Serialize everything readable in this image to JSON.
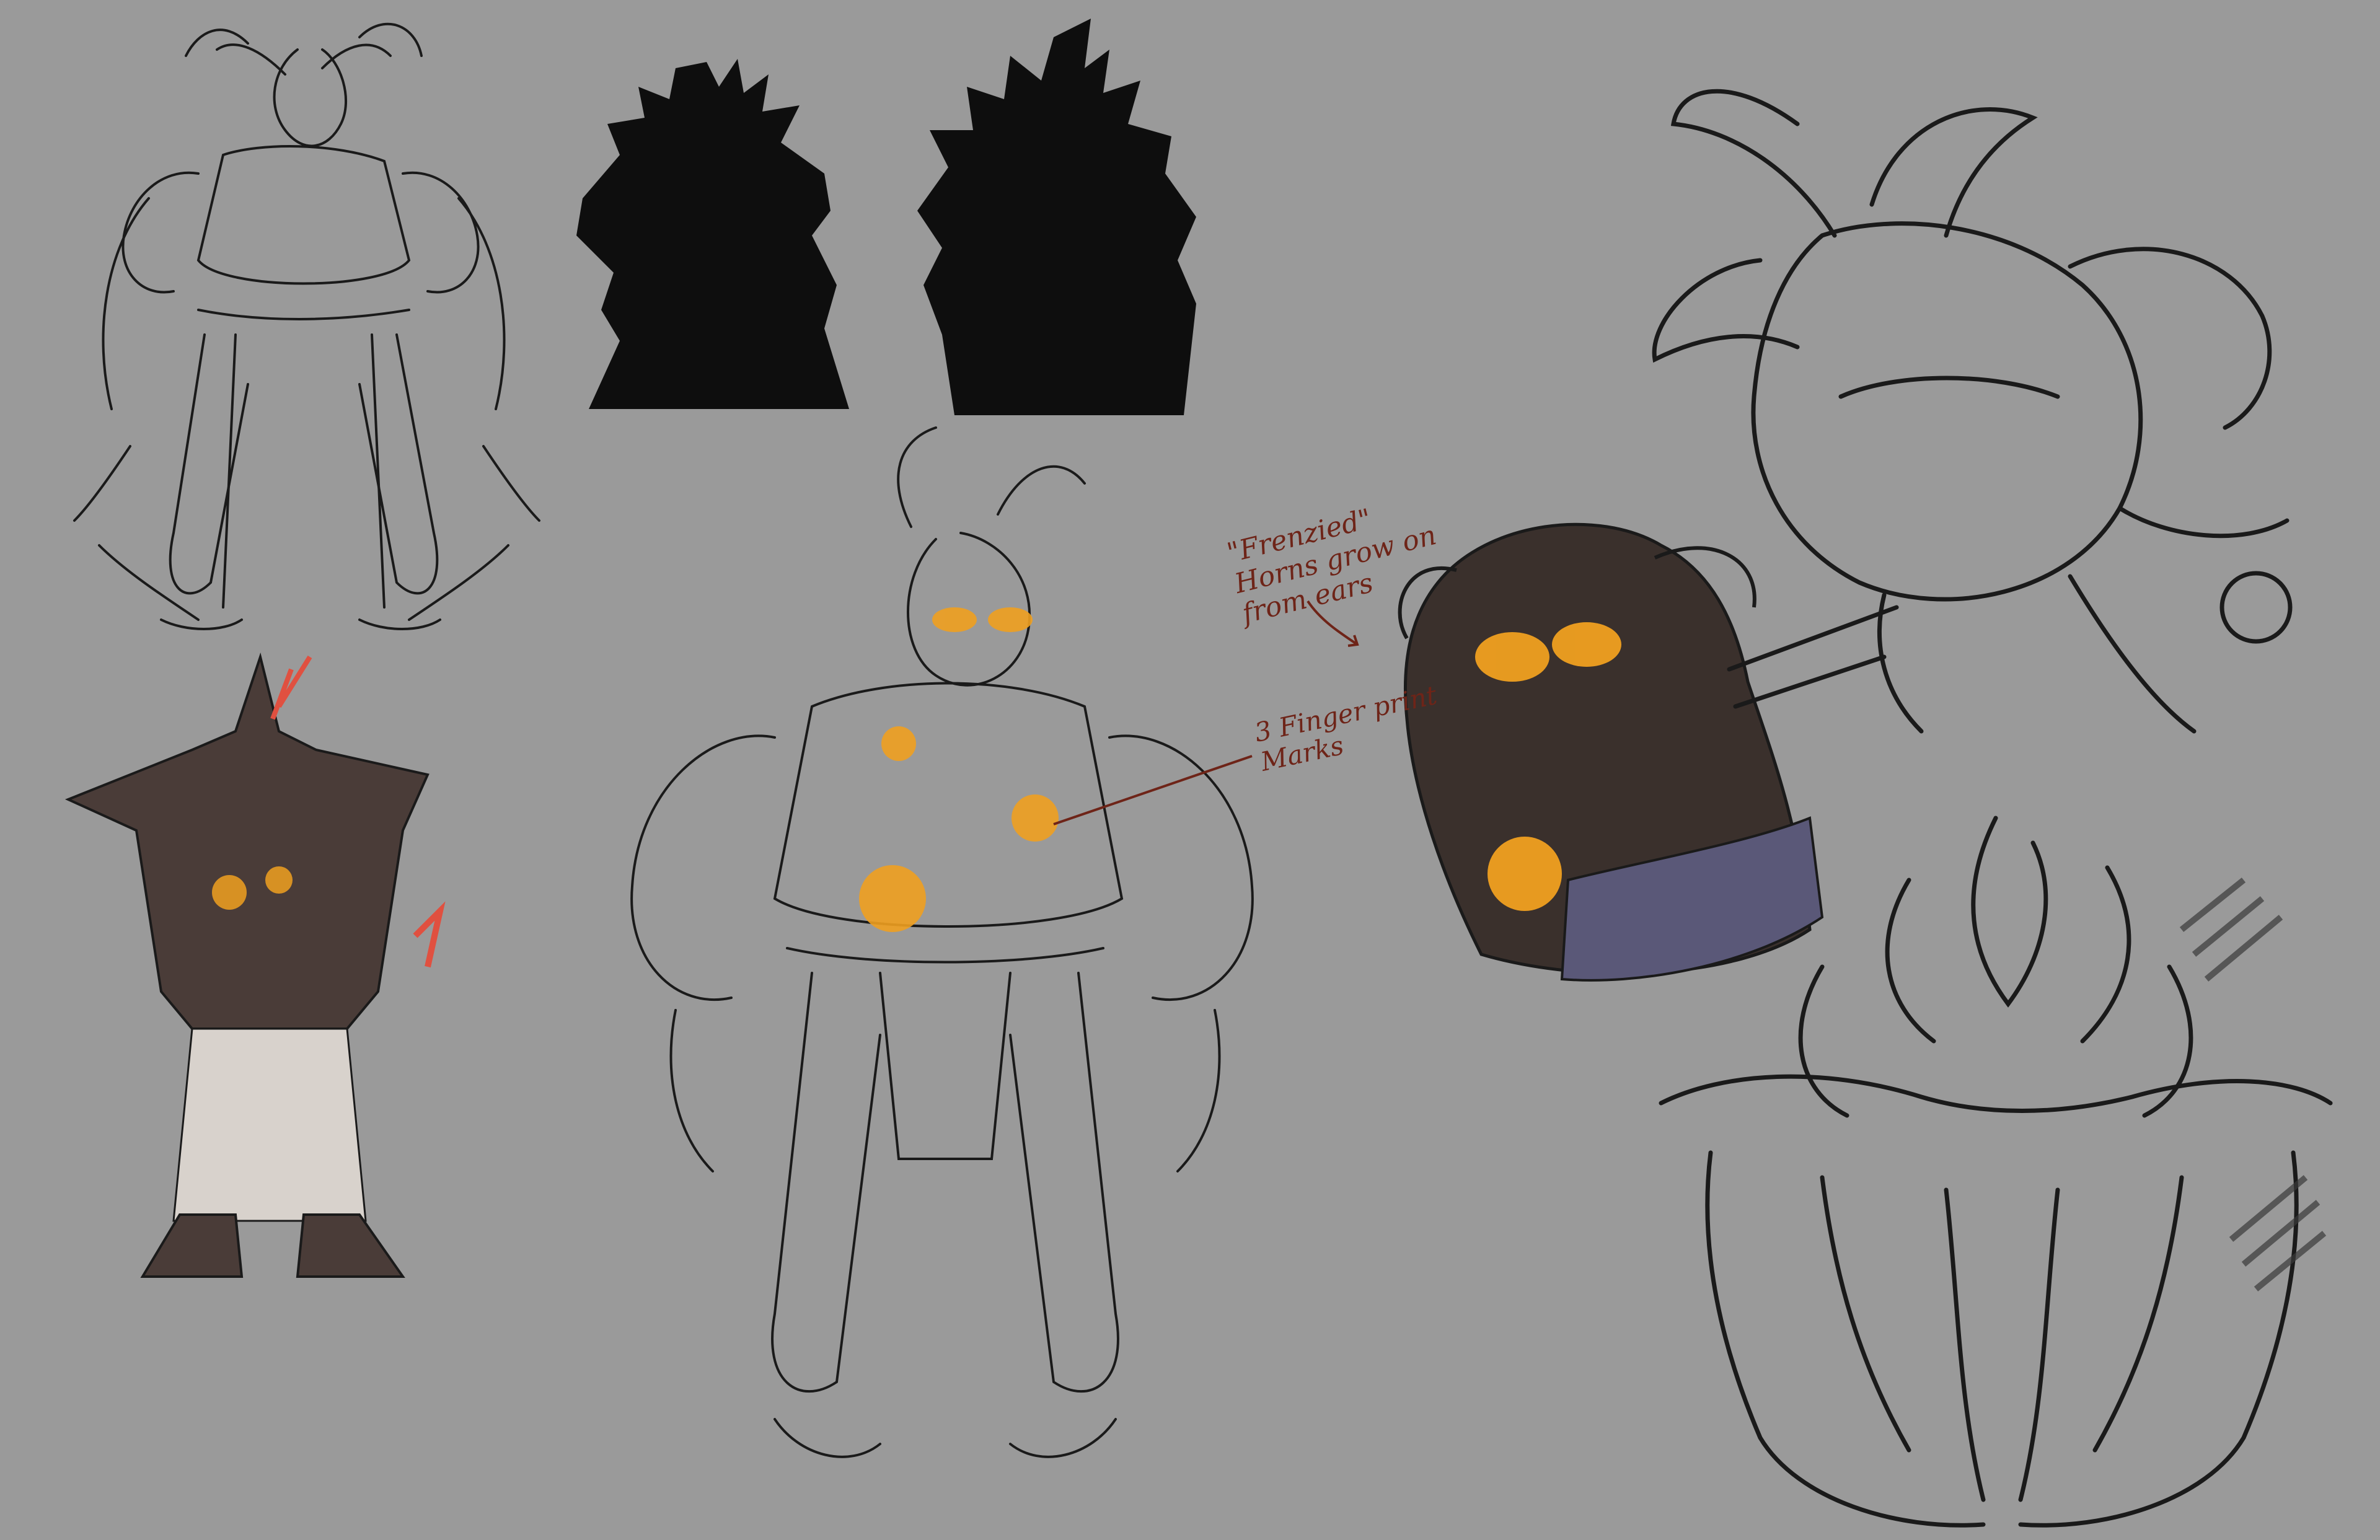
{
  "sheet": {
    "background": "#9a9a9a",
    "ink": "#1a1a1a",
    "glow": "#f0a020",
    "glow_core": "#ffcf5a",
    "dark_fill": "#4a3c38",
    "robe_blue": "#5a5878",
    "note_color": "#6e2418"
  },
  "annotations": {
    "frenzied": {
      "line1": "\"Frenzied\"",
      "line2": "Horns grow on",
      "line3": "from ears"
    },
    "finger_marks": {
      "line1": "3 Finger print",
      "line2": "Marks"
    }
  }
}
